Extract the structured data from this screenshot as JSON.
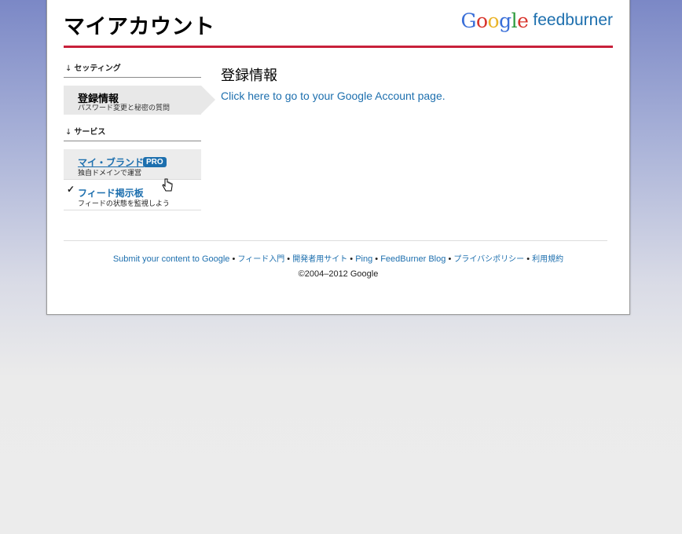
{
  "header": {
    "title": "マイアカウント",
    "logo_google": [
      "G",
      "o",
      "o",
      "g",
      "l",
      "e"
    ],
    "logo_product": "feedburner"
  },
  "sidebar": {
    "settings_heading": "セッティング",
    "settings_items": [
      {
        "label": "登録情報",
        "sub": "パスワード変更と秘密の質問"
      }
    ],
    "services_heading": "サービス",
    "services_items": [
      {
        "label": "マイ・ブランド",
        "badge": "PRO",
        "sub": "独自ドメインで運営"
      },
      {
        "label": "フィード掲示板",
        "sub": "フィードの状態を監視しよう",
        "checked": true
      }
    ]
  },
  "main": {
    "title": "登録情報",
    "link_text": "Click here to go to your Google Account page."
  },
  "footer": {
    "links": [
      "Submit your content to Google",
      "フィード入門",
      "開発者用サイト",
      "Ping",
      "FeedBurner Blog",
      "プライバシポリシー",
      "利用規約"
    ],
    "separator": "•",
    "copyright": "©2004–2012 Google"
  },
  "colors": {
    "accent": "#1d6fae",
    "header_rule": "#c8203a"
  }
}
